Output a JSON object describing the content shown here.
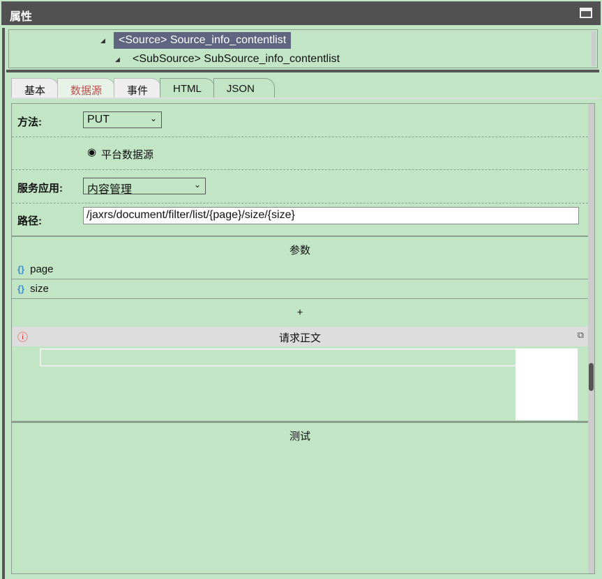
{
  "header": {
    "title": "属性"
  },
  "tree": {
    "source": "<Source> Source_info_contentlist",
    "subsource": "<SubSource> SubSource_info_contentlist"
  },
  "tabs": [
    "基本",
    "数据源",
    "事件",
    "HTML",
    "JSON"
  ],
  "form": {
    "method_label": "方法:",
    "method_value": "PUT",
    "radio_label": "平台数据源",
    "service_label": "服务应用:",
    "service_value": "内容管理",
    "path_label": "路径:",
    "path_value": "/jaxrs/document/filter/list/{page}/size/{size}"
  },
  "params": {
    "title": "参数",
    "items": [
      "page",
      "size"
    ],
    "add": "+"
  },
  "request_body": {
    "title": "请求正文"
  },
  "test": {
    "title": "测试"
  }
}
